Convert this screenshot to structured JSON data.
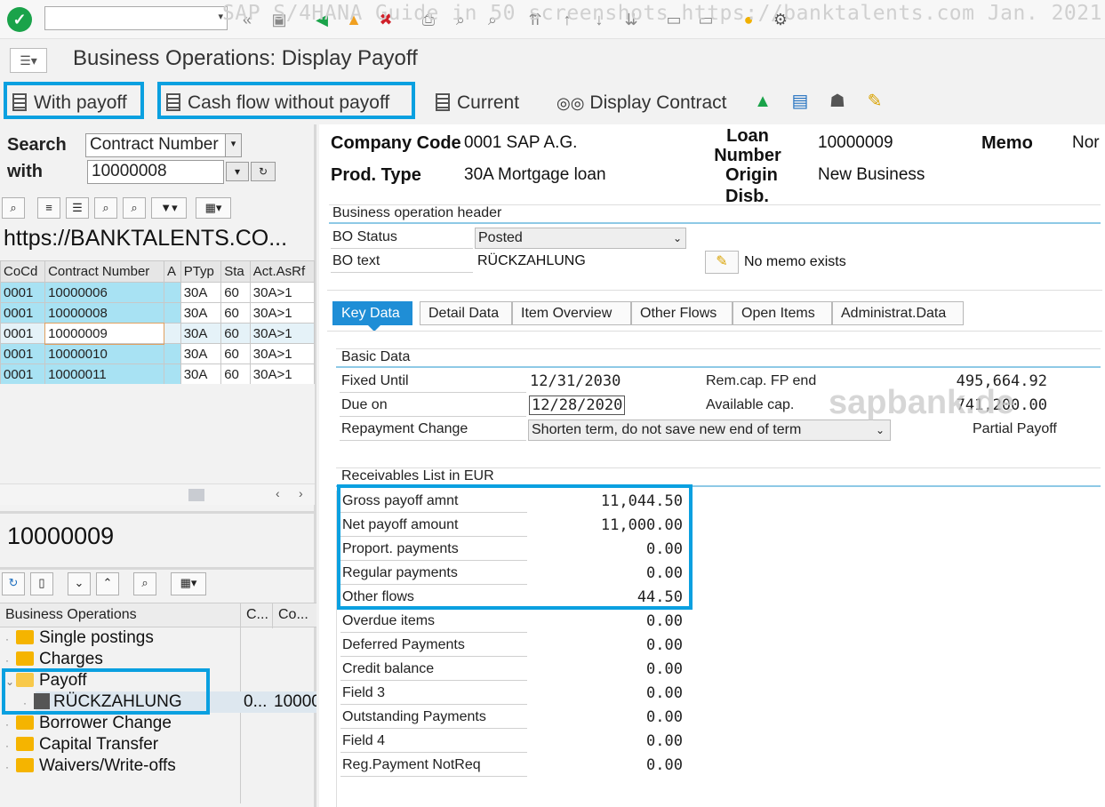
{
  "watermark": "SAP S/4HANA Guide in 50 screenshots https://banktalents.com Jan. 2021",
  "title": "Business Operations: Display Payoff",
  "app_toolbar": {
    "with_payoff": "With payoff",
    "cash_flow_without_payoff": "Cash flow without payoff",
    "current": "Current",
    "display_contract": "Display Contract"
  },
  "search": {
    "label_search": "Search",
    "label_with": "with",
    "field": "Contract Number",
    "value": "10000008"
  },
  "url_line": "https://BANKTALENTS.CO...",
  "contract_table": {
    "headers": [
      "CoCd",
      "Contract Number",
      "A",
      "PTyp",
      "Sta",
      "Act.AsRf"
    ],
    "rows": [
      [
        "0001",
        "10000006",
        "",
        "30A",
        "60",
        "30A>1"
      ],
      [
        "0001",
        "10000008",
        "",
        "30A",
        "60",
        "30A>1"
      ],
      [
        "0001",
        "10000009",
        "",
        "30A",
        "60",
        "30A>1"
      ],
      [
        "0001",
        "10000010",
        "",
        "30A",
        "60",
        "30A>1"
      ],
      [
        "0001",
        "10000011",
        "",
        "30A",
        "60",
        "30A>1"
      ]
    ]
  },
  "selected_contract": "10000009",
  "tree": {
    "col1": "Business Operations",
    "col2": "C...",
    "col3": "Co...",
    "items": [
      "Single postings",
      "Charges",
      "Payoff",
      "RÜCKZAHLUNG",
      "Borrower Change",
      "Capital Transfer",
      "Waivers/Write-offs"
    ],
    "child_col2": "0...",
    "child_col3": "10000"
  },
  "header": {
    "company_code_label": "Company Code",
    "company_code_value": "0001 SAP A.G.",
    "prod_type_label": "Prod. Type",
    "prod_type_value": "30A Mortgage loan",
    "loan_number_label": "Loan Number",
    "loan_number_value": "10000009",
    "origin_label": "Origin",
    "origin_value": "New Business",
    "disb_label": "Disb.",
    "memo_label": "Memo",
    "memo_value": "Nor"
  },
  "bo_header": {
    "section": "Business operation header",
    "status_label": "BO Status",
    "status_value": "Posted",
    "text_label": "BO text",
    "text_value": "RÜCKZAHLUNG",
    "memo_text": "No memo exists"
  },
  "tabs": [
    "Key Data",
    "Detail Data",
    "Item Overview",
    "Other Flows",
    "Open Items",
    "Administrat.Data"
  ],
  "basic_data": {
    "section": "Basic Data",
    "fixed_until_label": "Fixed Until",
    "fixed_until_value": "12/31/2030",
    "due_on_label": "Due on",
    "due_on_value": "12/28/2020",
    "repayment_change_label": "Repayment Change",
    "repayment_change_value": "Shorten term, do not save new end of term",
    "rem_cap_label": "Rem.cap. FP end",
    "rem_cap_value": "495,664.92",
    "available_cap_label": "Available cap.",
    "available_cap_value": "741,200.00",
    "partial_payoff": "Partial Payoff",
    "sapbank_watermark": "sapbank.de"
  },
  "receivables": {
    "section": "Receivables List in EUR",
    "rows": [
      {
        "label": "Gross payoff amnt",
        "value": "11,044.50"
      },
      {
        "label": "Net payoff amount",
        "value": "11,000.00"
      },
      {
        "label": "Proport. payments",
        "value": "0.00"
      },
      {
        "label": "Regular payments",
        "value": "0.00"
      },
      {
        "label": "Other flows",
        "value": "44.50"
      },
      {
        "label": "Overdue items",
        "value": "0.00"
      },
      {
        "label": "Deferred Payments",
        "value": "0.00"
      },
      {
        "label": "Credit balance",
        "value": "0.00"
      },
      {
        "label": "Field 3",
        "value": "0.00"
      },
      {
        "label": "Outstanding Payments",
        "value": "0.00"
      },
      {
        "label": "Field 4",
        "value": "0.00"
      },
      {
        "label": "Reg.Payment NotReq",
        "value": "0.00"
      }
    ]
  }
}
